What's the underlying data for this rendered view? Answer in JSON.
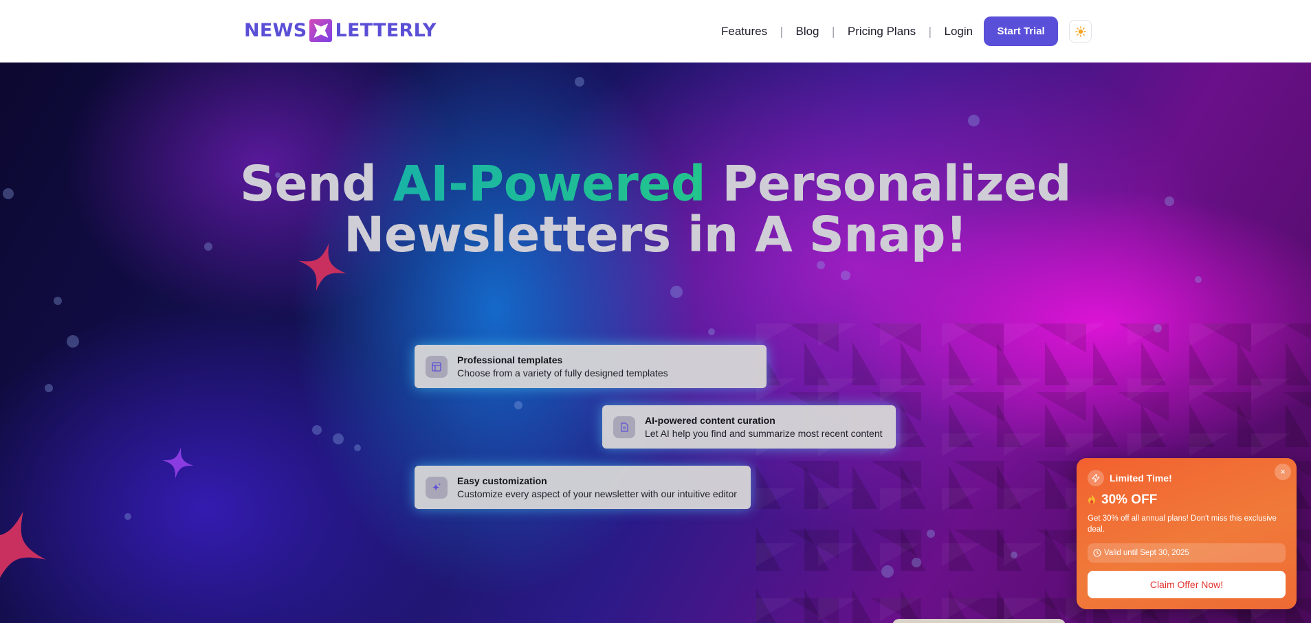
{
  "logo": {
    "text_left": "NEWS",
    "text_right": "LETTERLY"
  },
  "nav": {
    "features": "Features",
    "blog": "Blog",
    "pricing": "Pricing Plans",
    "login": "Login",
    "separator": "|",
    "start_trial": "Start Trial",
    "theme_icon": "sun-icon"
  },
  "hero": {
    "headline_part1": "Send ",
    "headline_accent": "AI-Powered",
    "headline_part2": " Personalized",
    "headline_line2": "Newsletters in A Snap!"
  },
  "features": [
    {
      "icon": "template-icon",
      "title": "Professional templates",
      "desc": "Choose from a variety of fully designed templates"
    },
    {
      "icon": "document-icon",
      "title": "AI-powered content curation",
      "desc": "Let AI help you find and summarize most recent content"
    },
    {
      "icon": "sparkles-icon",
      "title": "Easy customization",
      "desc": "Customize every aspect of your newsletter with our intuitive editor"
    }
  ],
  "promo": {
    "title": "Limited Time!",
    "discount": "30% OFF",
    "text": "Get 30% off all annual plans! Don't miss this exclusive deal.",
    "valid": "Valid until Sept 30, 2025",
    "cta": "Claim Offer Now!",
    "close": "×"
  },
  "colors": {
    "brand": "#5a4fd8",
    "accent": "#1ab3a6",
    "promo": "#f2612f"
  }
}
